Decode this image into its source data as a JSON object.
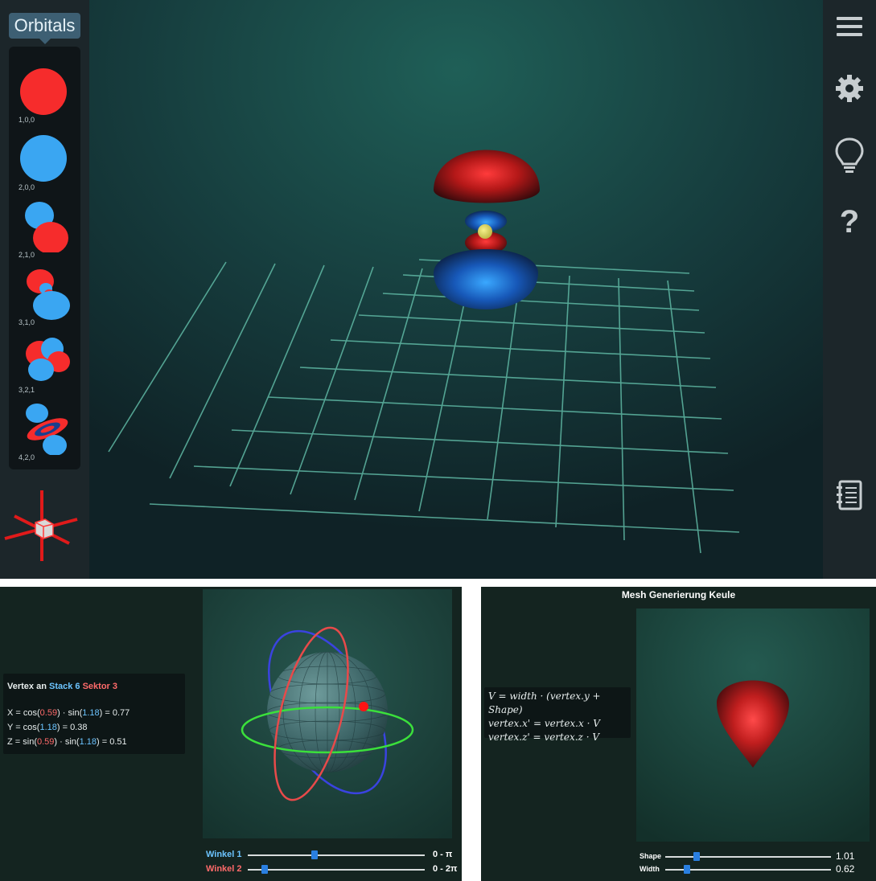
{
  "sidebar": {
    "tooltip": "Orbitals",
    "orbitals": [
      {
        "label": "1,0,0",
        "icon": "orbital-1s-icon"
      },
      {
        "label": "2,0,0",
        "icon": "orbital-2s-icon"
      },
      {
        "label": "2,1,0",
        "icon": "orbital-2p-icon"
      },
      {
        "label": "3,1,0",
        "icon": "orbital-3p-icon"
      },
      {
        "label": "3,2,1",
        "icon": "orbital-3d-icon"
      },
      {
        "label": "4,2,0",
        "icon": "orbital-4d-icon"
      }
    ],
    "axis_icon": "axis-gizmo-icon"
  },
  "toolbar": {
    "icons": [
      "menu-icon",
      "gear-icon",
      "lightbulb-icon",
      "help-icon",
      "notebook-icon"
    ],
    "help_glyph": "?"
  },
  "vertex_panel": {
    "title_prefix": "Vertex an",
    "stack": "Stack 6",
    "sektor": "Sektor 3",
    "x_line": {
      "pre": "X = cos(",
      "a": "0.59",
      "mid": ") · sin(",
      "b": "1.18",
      "post": ") = 0.77"
    },
    "y_line": {
      "pre": "Y = cos(",
      "a": "1.18",
      "post": ") = 0.38"
    },
    "z_line": {
      "pre": "Z = sin(",
      "a": "0.59",
      "mid": ") · sin(",
      "b": "1.18",
      "post": ") = 0.51"
    },
    "slider1": {
      "label": "Winkel 1",
      "range": "0 - π",
      "value": 0.378
    },
    "slider2": {
      "label": "Winkel 2",
      "range": "0 - 2π",
      "value": 0.094
    }
  },
  "mesh_panel": {
    "title": "Mesh Generierung Keule",
    "formula1": "V = width · (vertex.y + Shape)",
    "formula2": "vertex.x' = vertex.x · V",
    "formula3": "vertex.z' = vertex.z · V",
    "shape": {
      "label": "Shape",
      "value": "1.01",
      "fraction": 0.19
    },
    "width": {
      "label": "Width",
      "value": "0.62",
      "fraction": 0.13
    }
  },
  "colors": {
    "accent_blue": "#2a7fe0",
    "lobe_red": "#e02828",
    "lobe_blue": "#2e9bf0",
    "grid": "#5fb8a4"
  }
}
